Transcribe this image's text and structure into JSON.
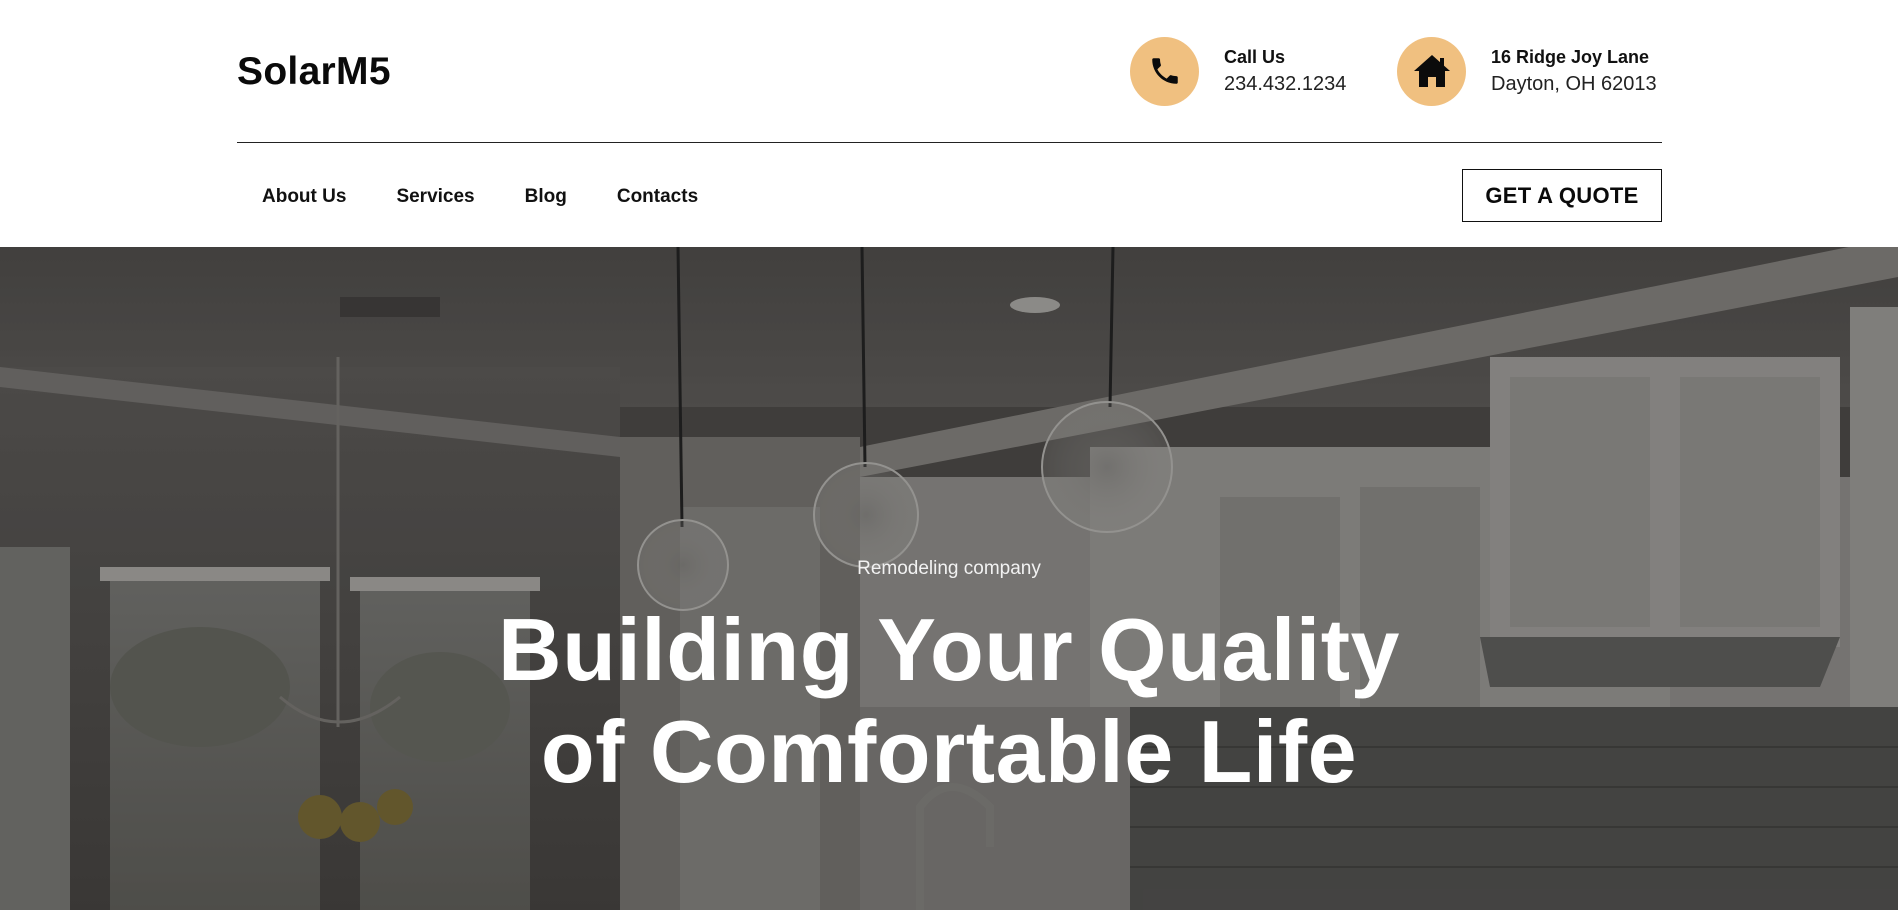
{
  "brand": {
    "logo": "SolarM5"
  },
  "contacts": {
    "call": {
      "title": "Call Us",
      "value": "234.432.1234",
      "icon": "phone-icon"
    },
    "address": {
      "title": "16 Ridge Joy Lane",
      "value": "Dayton, OH 62013",
      "icon": "home-icon"
    }
  },
  "colors": {
    "icon_circle": "#f0c080"
  },
  "nav": {
    "items": [
      {
        "label": "About Us"
      },
      {
        "label": "Services"
      },
      {
        "label": "Blog"
      },
      {
        "label": "Contacts"
      }
    ],
    "cta_label": "GET A QUOTE"
  },
  "hero": {
    "kicker": "Remodeling company",
    "title_line1": "Building Your Quality",
    "title_line2": "of Comfortable Life"
  }
}
